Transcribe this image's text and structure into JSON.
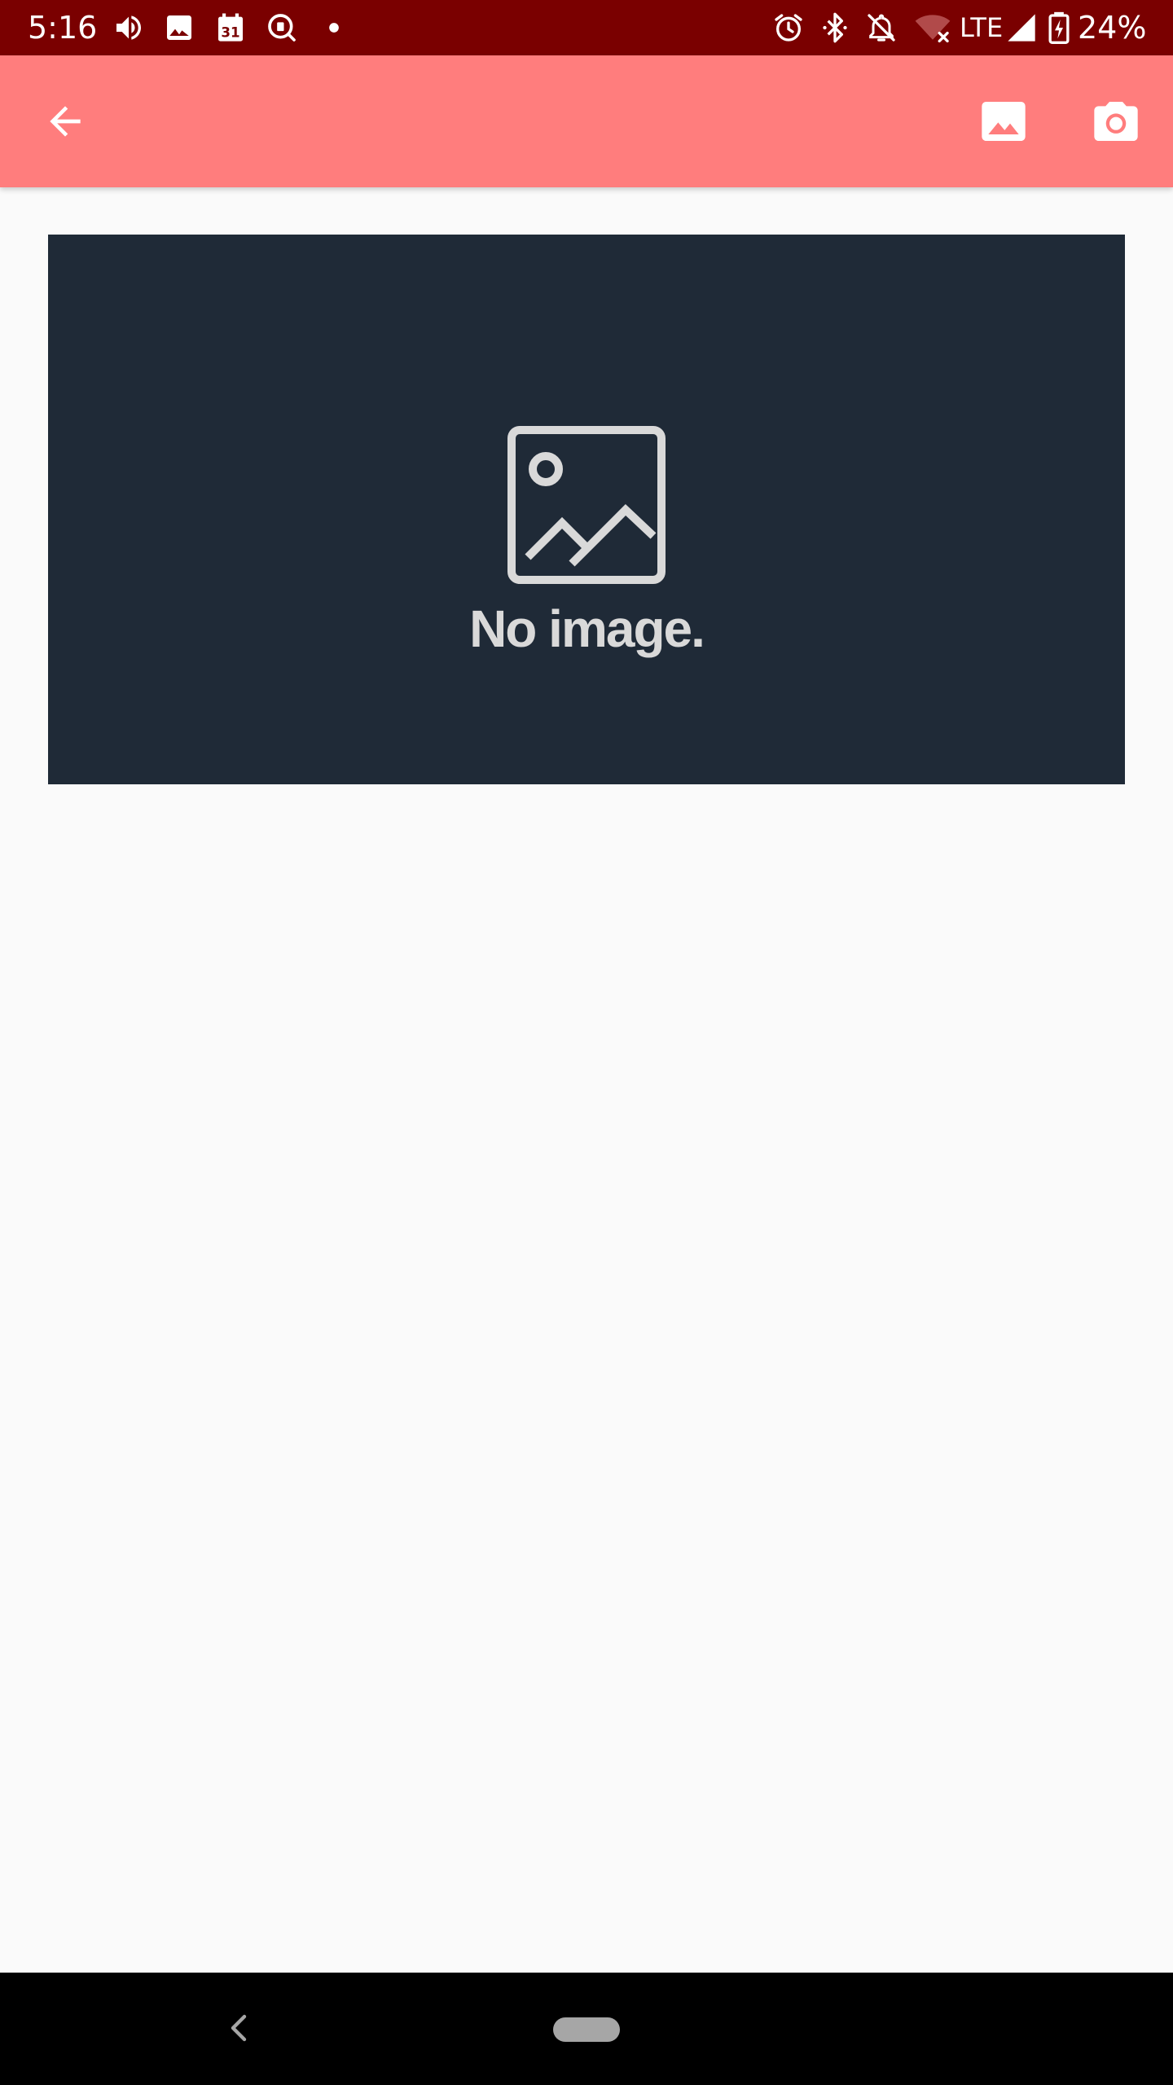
{
  "status_bar": {
    "time": "5:16",
    "network": "LTE",
    "battery": "24%",
    "icons": [
      "volume-icon",
      "image-icon",
      "calendar-icon",
      "search-icon",
      "dot-icon",
      "alarm-icon",
      "bluetooth-icon",
      "bell-off-icon",
      "wifi-off-icon",
      "signal-icon",
      "battery-charging-icon"
    ],
    "calendar_day": "31"
  },
  "app_bar": {
    "color": "#ff7d7d",
    "actions": [
      "back-arrow-icon",
      "gallery-icon",
      "camera-icon"
    ]
  },
  "placeholder": {
    "text": "No image.",
    "icon": "image-placeholder-icon",
    "background": "#1f2a37"
  },
  "nav_bar": {
    "buttons": [
      "nav-back-icon",
      "nav-home-pill"
    ]
  }
}
